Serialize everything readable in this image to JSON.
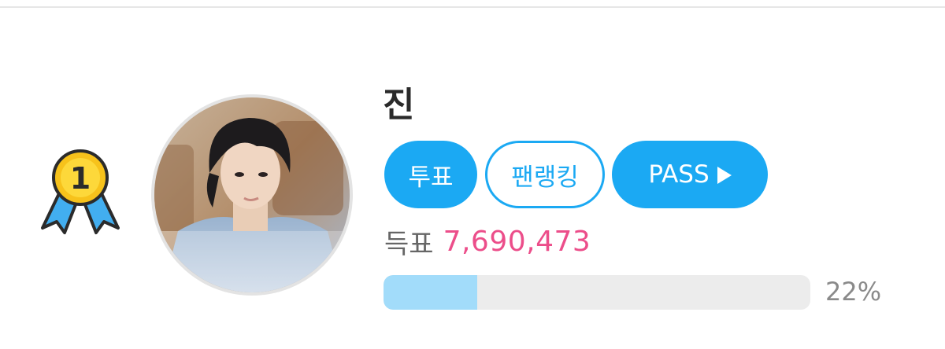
{
  "ranking": {
    "rank": "1",
    "artist_name": "진",
    "buttons": {
      "vote_label": "투표",
      "fanranking_label": "팬랭킹",
      "pass_label": "PASS"
    },
    "votes": {
      "label": "득표",
      "count": "7,690,473"
    },
    "progress": {
      "percent_text": "22%",
      "fraction": 0.22
    }
  },
  "icons": {
    "medal": "rank-1-medal-icon",
    "play": "play-triangle-icon"
  },
  "colors": {
    "accent": "#1ba9f3",
    "votes_count": "#ec4e8a",
    "progress_fill": "#a2dcfa",
    "progress_track": "#ececec",
    "medal_gold": "#f7c21b",
    "medal_ribbon": "#42aef0"
  }
}
